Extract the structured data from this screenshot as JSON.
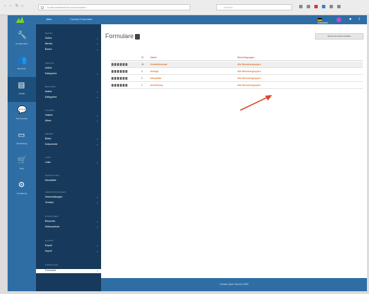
{
  "browser": {
    "url": "localhost/admin/formulare/index",
    "search_placeholder": "Suchen"
  },
  "appbar": {
    "user": "Max",
    "breadcrumb": "Contao Formulare",
    "language": "Deutsch"
  },
  "iconbar": [
    {
      "icon": "wrench-icon",
      "label": "Konfiguration"
    },
    {
      "icon": "users-icon",
      "label": "Benutzer"
    },
    {
      "icon": "document-icon",
      "label": "Inhalte"
    },
    {
      "icon": "chat-icon",
      "label": "Kommentare"
    },
    {
      "icon": "monitor-icon",
      "label": "Darstellung"
    },
    {
      "icon": "cart-icon",
      "label": "Shop"
    },
    {
      "icon": "gear-icon",
      "label": "Verwaltung"
    }
  ],
  "subbar": {
    "sections": [
      {
        "title": "Seiten",
        "items": [
          "Seiten",
          "Menüs",
          "Boxen"
        ]
      },
      {
        "title": "Inhalte",
        "items": [
          "Artikel",
          "Kategorien"
        ]
      },
      {
        "title": "Beiträge",
        "items": [
          "Artikel",
          "Kategorien"
        ]
      },
      {
        "title": "Galerie",
        "items": [
          "Galerie",
          "Alben"
        ]
      },
      {
        "title": "Medien",
        "items": [
          "Bilder",
          "Dokumente"
        ]
      },
      {
        "title": "Links",
        "items": [
          "Links"
        ]
      },
      {
        "title": "Newsletter",
        "items": [
          "Newsletter"
        ]
      },
      {
        "title": "Veranstaltungen",
        "items": [
          "Veranstaltungen",
          "Termine"
        ]
      },
      {
        "title": "Statistiken",
        "items": [
          "Besucher",
          "Seitenaufrufe"
        ]
      },
      {
        "title": "Export",
        "items": [
          "Export",
          "Import"
        ]
      },
      {
        "title": "Formulare",
        "items": [
          "Formulare"
        ]
      }
    ]
  },
  "main": {
    "title": "Formulare",
    "new_button": "Neues Formular erstellen",
    "columns": {
      "id": "ID",
      "name": "Name",
      "permission": "Berechtigungen"
    },
    "rows": [
      {
        "id": "10",
        "name": "Kontaktformular",
        "permission": "Alle Benutzergruppen"
      },
      {
        "id": "3",
        "name": "Anfrage",
        "permission": "Alle Benutzergruppen"
      },
      {
        "id": "2",
        "name": "Newsletter",
        "permission": "Alle Benutzergruppen"
      },
      {
        "id": "1",
        "name": "Anmeldung",
        "permission": "Alle Benutzergruppen"
      }
    ]
  },
  "footer": {
    "text": "Contao Open Source CMS"
  }
}
